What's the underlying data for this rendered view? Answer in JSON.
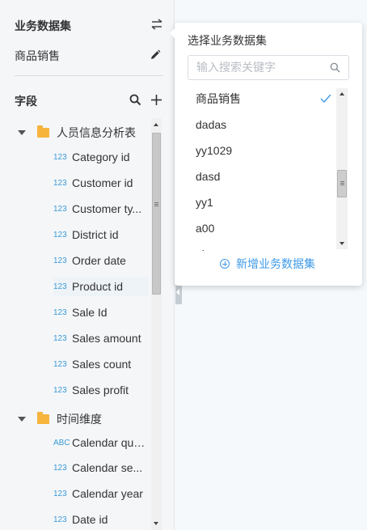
{
  "sidebar": {
    "dataset_section_title": "业务数据集",
    "current_dataset": "商品销售",
    "fields_section_title": "字段",
    "groups": [
      {
        "label": "人员信息分析表",
        "fields": [
          {
            "type": "123",
            "name": "Category id"
          },
          {
            "type": "123",
            "name": "Customer id"
          },
          {
            "type": "123",
            "name": "Customer ty..."
          },
          {
            "type": "123",
            "name": "District id"
          },
          {
            "type": "123",
            "name": "Order date"
          },
          {
            "type": "123",
            "name": "Product id"
          },
          {
            "type": "123",
            "name": "Sale Id"
          },
          {
            "type": "123",
            "name": "Sales amount"
          },
          {
            "type": "123",
            "name": "Sales count"
          },
          {
            "type": "123",
            "name": "Sales profit"
          }
        ]
      },
      {
        "label": "时间维度",
        "fields": [
          {
            "type": "ABC",
            "name": "Calendar qua..."
          },
          {
            "type": "123",
            "name": "Calendar se..."
          },
          {
            "type": "123",
            "name": "Calendar year"
          },
          {
            "type": "123",
            "name": "Date id"
          }
        ]
      }
    ]
  },
  "popup": {
    "title": "选择业务数据集",
    "search_placeholder": "输入搜索关键字",
    "items": [
      "商品销售",
      "dadas",
      "yy1029",
      "dasd",
      "yy1",
      "a00",
      "abc"
    ],
    "selected_index": 0,
    "add_label": "新增业务数据集"
  },
  "colors": {
    "accent": "#3d9ae8",
    "field_type": "#3b9bd9",
    "folder": "#f6b43d"
  }
}
